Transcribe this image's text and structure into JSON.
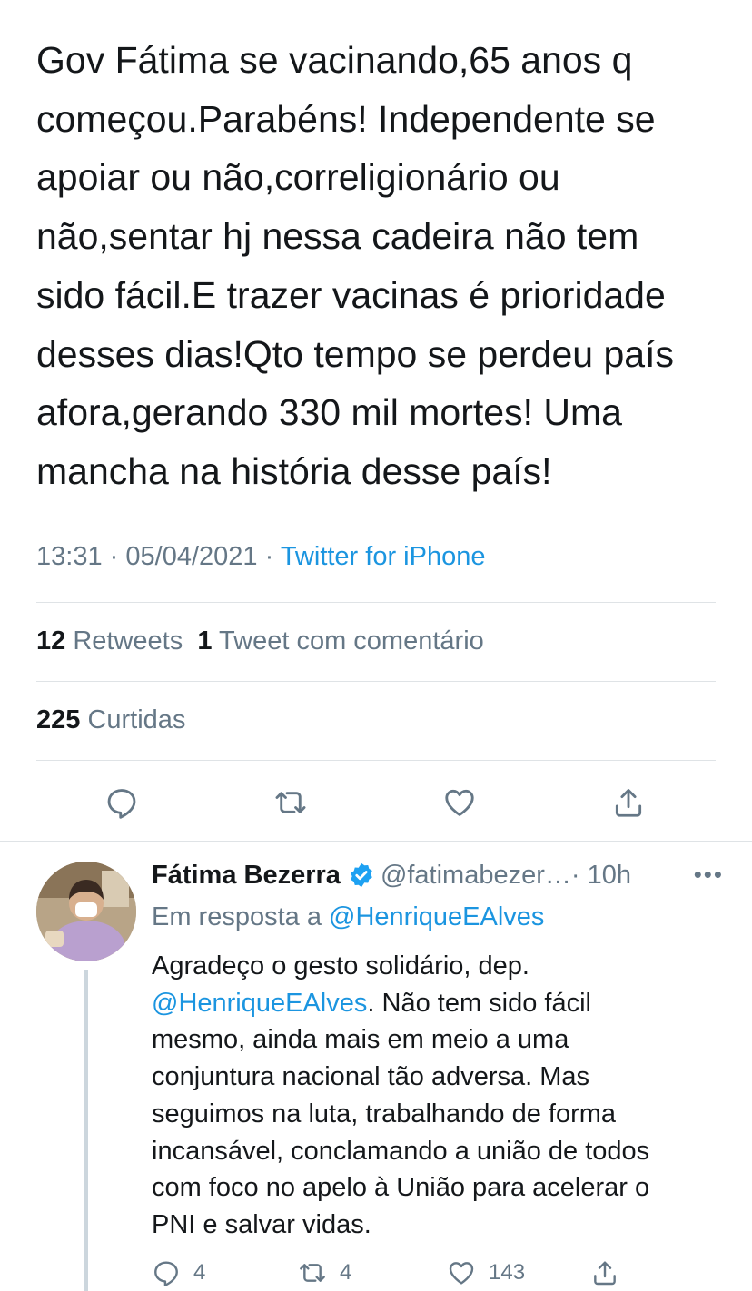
{
  "tweet": {
    "text": "Gov Fátima se vacinando,65 anos q\ncomeçou.Parabéns! Independente se\napoiar ou não,correligionário ou\nnão,sentar hj nessa cadeira não tem\nsido fácil.E trazer vacinas é prioridade\ndesses dias!Qto tempo se perdeu país\nafora,gerando 330 mil mortes! Uma\nmancha na história desse país!",
    "time": "13:31",
    "date": "05/04/2021",
    "separator": "·",
    "source": "Twitter for iPhone"
  },
  "stats": {
    "retweets_count": "12",
    "retweets_label": "Retweets",
    "quotes_count": "1",
    "quotes_label": "Tweet com comentário",
    "likes_count": "225",
    "likes_label": "Curtidas"
  },
  "actions": {
    "icons": [
      "reply-icon",
      "retweet-icon",
      "like-icon",
      "share-icon"
    ]
  },
  "reply": {
    "name": "Fátima Bezerra",
    "handle": "@fatimabezer…",
    "age": "· 10h",
    "more": "•••",
    "in_reply_prefix": "Em resposta a",
    "in_reply_handle": "@HenriqueEAlves",
    "body_part1": "Agradeço o gesto solidário, dep.\n",
    "body_mention": "@HenriqueEAlves",
    "body_part2": ". Não tem sido fácil\nmesmo, ainda mais em meio a uma\nconjuntura nacional tão adversa. Mas\nseguimos na luta,  trabalhando de forma\nincansável, conclamando a união de todos\ncom foco no apelo à União para acelerar o\nPNI e salvar vidas.",
    "reply_count": "4",
    "retweet_count": "4",
    "like_count": "143"
  },
  "colors": {
    "text": "#14171a",
    "secondary": "#657786",
    "link": "#1b95e0",
    "divider": "#dfe3e6",
    "verified": "#1da1f2"
  }
}
